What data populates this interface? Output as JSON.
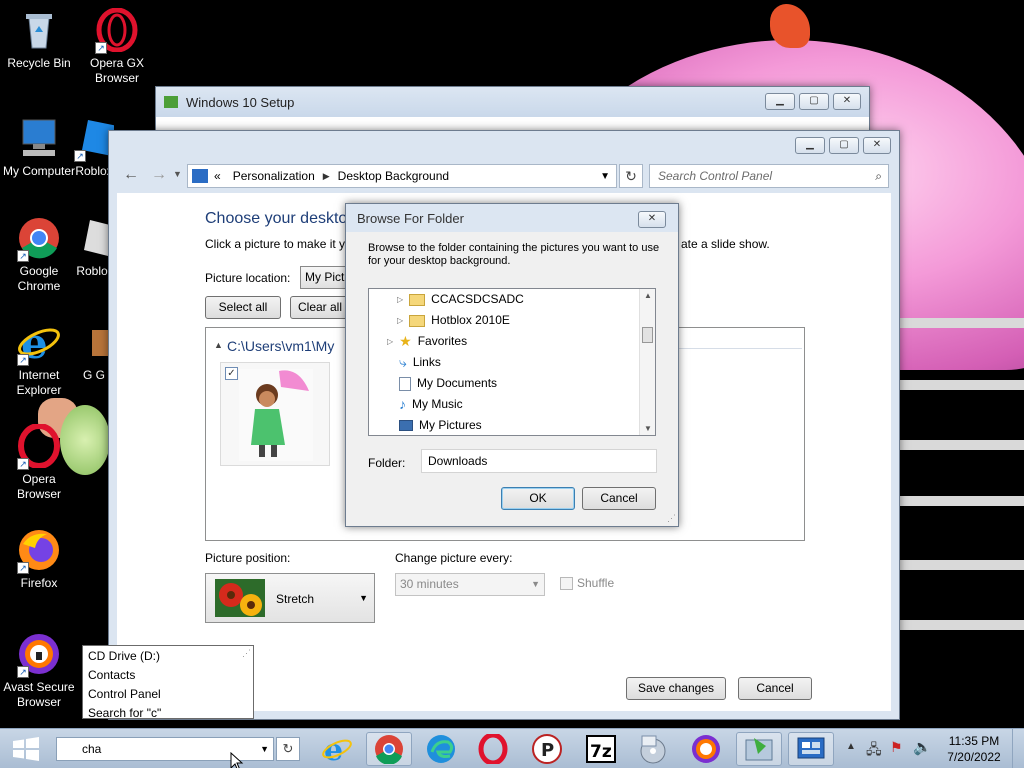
{
  "desktop": {
    "icons": [
      {
        "label": "Recycle Bin"
      },
      {
        "label": "Opera GX Browser"
      },
      {
        "label": "My Computer"
      },
      {
        "label": "Roblox"
      },
      {
        "label": "Google Chrome"
      },
      {
        "label": "Roblo"
      },
      {
        "label": "Internet Explorer"
      },
      {
        "label": "G G"
      },
      {
        "label": "Opera Browser"
      },
      {
        "label": "Firefox"
      },
      {
        "label": "Avast Secure Browser"
      }
    ]
  },
  "setup_window": {
    "title": "Windows 10 Setup"
  },
  "control_panel": {
    "breadcrumb_prefix": "«",
    "breadcrumb": [
      "Personalization",
      "Desktop Background"
    ],
    "search_placeholder": "Search Control Panel",
    "heading": "Choose your desktop",
    "instruction": "Click a picture to make it y",
    "instruction_tail": "ate a slide show.",
    "picture_location_label": "Picture location:",
    "picture_location_value": "My Pict",
    "select_all": "Select all",
    "clear_all": "Clear all",
    "folder_path": "C:\\Users\\vm1\\My",
    "picture_checked": true,
    "picture_position_label": "Picture position:",
    "picture_position_value": "Stretch",
    "change_every_label": "Change picture every:",
    "change_every_value": "30 minutes",
    "shuffle_label": "Shuffle",
    "save_changes": "Save changes",
    "cancel": "Cancel"
  },
  "dialog": {
    "title": "Browse For Folder",
    "description": "Browse to the folder containing the pictures you want to use for your desktop background.",
    "tree": [
      {
        "label": "CCACSDCSADC",
        "icon": "folder-icon"
      },
      {
        "label": "Hotblox 2010E",
        "icon": "folder-icon"
      },
      {
        "label": "Favorites",
        "icon": "star-icon"
      },
      {
        "label": "Links",
        "icon": "link-icon"
      },
      {
        "label": "My Documents",
        "icon": "document-icon"
      },
      {
        "label": "My Music",
        "icon": "music-icon"
      },
      {
        "label": "My Pictures",
        "icon": "picture-icon"
      }
    ],
    "folder_label": "Folder:",
    "folder_value": "Downloads",
    "ok": "OK",
    "cancel": "Cancel"
  },
  "autocomplete": {
    "items": [
      "CD Drive (D:)",
      "Contacts",
      "Control Panel",
      "Search for \"c\""
    ]
  },
  "taskbar": {
    "run_input": "cha",
    "clock_time": "11:35 PM",
    "clock_date": "7/20/2022"
  },
  "colors": {
    "heading_blue": "#1e3e78",
    "taskbar_bg": "#b7c8dc"
  }
}
